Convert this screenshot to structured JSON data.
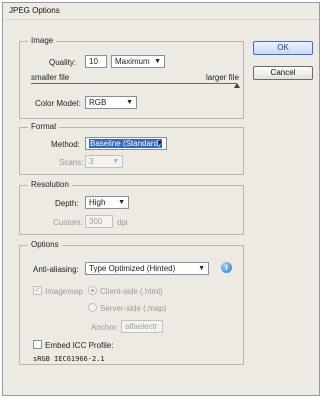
{
  "window": {
    "title": "JPEG Options"
  },
  "buttons": {
    "ok": "OK",
    "cancel": "Cancel"
  },
  "image_group": {
    "legend": "Image",
    "quality_label": "Quality:",
    "quality_value": "10",
    "quality_preset": "Maximum",
    "smaller_file": "smaller file",
    "larger_file": "larger file",
    "quality_level": 1.0,
    "color_model_label": "Color Model:",
    "color_model_value": "RGB"
  },
  "format_group": {
    "legend": "Format",
    "method_label": "Method:",
    "method_value": "Baseline (Standard)",
    "scans_label": "Scans:",
    "scans_value": "3"
  },
  "resolution_group": {
    "legend": "Resolution",
    "depth_label": "Depth:",
    "depth_value": "High",
    "custom_label": "Custom:",
    "custom_value": "300",
    "custom_unit": "dpi"
  },
  "options_group": {
    "legend": "Options",
    "antialias_label": "Anti-aliasing:",
    "antialias_value": "Type Optimized (Hinted)",
    "imagemap_label": "Imagemap",
    "imagemap_checked": true,
    "client_side_label": "Client-side (.html)",
    "server_side_label": "Server-side (.map)",
    "anchor_label": "Anchor:",
    "anchor_value": "alfaelectr",
    "embed_icc_label": "Embed ICC Profile:",
    "icc_profile_name": "sRGB IEC61966-2.1"
  },
  "icons": {
    "info": "info-icon",
    "dropdown": "chevron-down-icon"
  }
}
